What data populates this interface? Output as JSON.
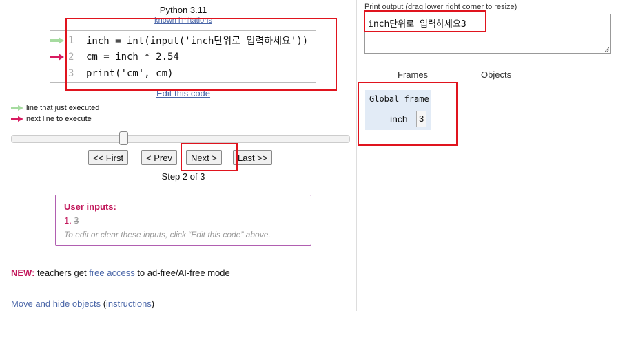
{
  "header": {
    "title": "Python 3.11",
    "limits_link": "known limitations"
  },
  "code": {
    "lines": [
      {
        "num": "1",
        "text": "inch = int(input('inch단위로 입력하세요'))",
        "arrow": "light-green-arrow"
      },
      {
        "num": "2",
        "text": "cm = inch * 2.54",
        "arrow": "red-arrow"
      },
      {
        "num": "3",
        "text": "print('cm', cm)",
        "arrow": ""
      }
    ]
  },
  "edit_link": "Edit this code",
  "legend": {
    "just_executed": "line that just executed",
    "next_to_execute": "next line to execute"
  },
  "slider": {
    "step": 2,
    "total": 3
  },
  "nav": {
    "first": "<< First",
    "prev": "< Prev",
    "next": "Next >",
    "last": "Last >>"
  },
  "step_label": "Step 2 of 3",
  "user_inputs": {
    "title": "User inputs:",
    "item_number": "1.",
    "item_value": "3",
    "hint": "To edit or clear these inputs, click “Edit this code” above."
  },
  "news": {
    "tag": "NEW:",
    "before": " teachers get ",
    "link": "free access",
    "after": " to ad-free/AI-free mode"
  },
  "move": {
    "link1": "Move and hide objects",
    "open": " (",
    "link2": "instructions",
    "close": ")"
  },
  "print_output": {
    "label": "Print output (drag lower right corner to resize)",
    "text": "inch단위로 입력하세요3"
  },
  "frames": {
    "frames_header": "Frames",
    "objects_header": "Objects",
    "global_frame": "Global frame",
    "variables": [
      {
        "name": "inch",
        "value": "3"
      }
    ]
  },
  "colors": {
    "link": "#4a66a8",
    "accent": "#c2185b",
    "highlight": "#e0141e",
    "frame_bg": "#e2ebf6",
    "executed_arrow": "#a6dba0",
    "next_arrow": "#d81b60"
  }
}
